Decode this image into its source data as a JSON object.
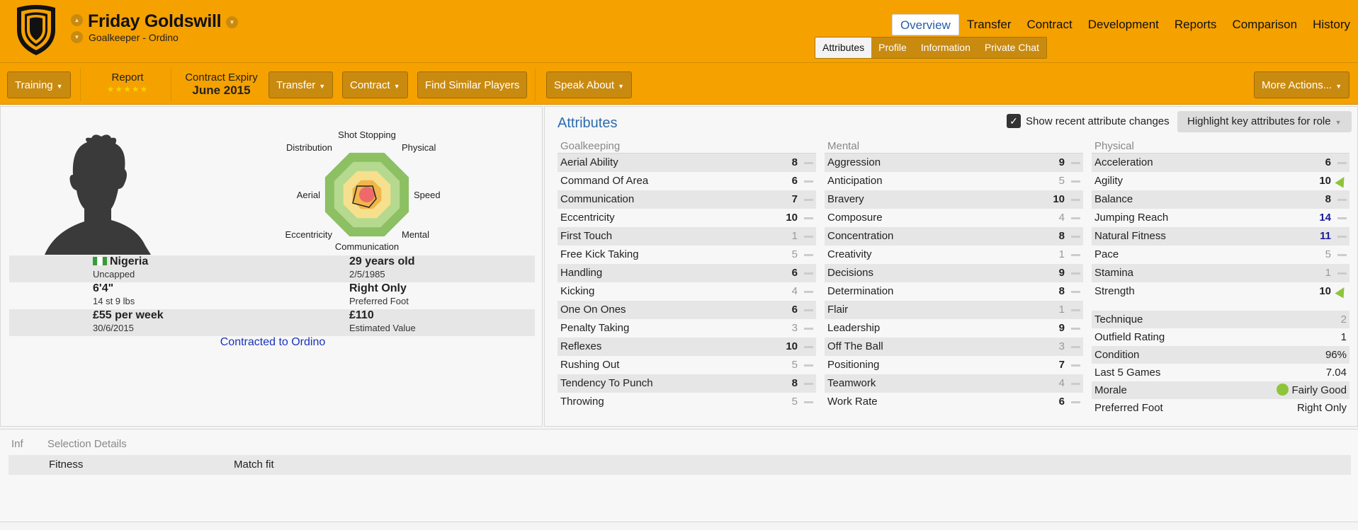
{
  "header": {
    "player_name": "Friday Goldswill",
    "position_club": "Goalkeeper - Ordino",
    "nav_tabs": [
      "Overview",
      "Transfer",
      "Contract",
      "Development",
      "Reports",
      "Comparison",
      "History"
    ],
    "sub_tabs": [
      "Attributes",
      "Profile",
      "Information",
      "Private Chat"
    ],
    "active_nav": "Overview",
    "active_sub": "Attributes"
  },
  "toolbar": {
    "training": "Training",
    "report_label": "Report",
    "report_stars": "★★★★★",
    "contract_expiry_label": "Contract Expiry",
    "contract_expiry_value": "June 2015",
    "transfer": "Transfer",
    "contract": "Contract",
    "find_similar": "Find Similar Players",
    "speak_about": "Speak About",
    "more_actions": "More Actions..."
  },
  "profile": {
    "nationality": "Nigeria",
    "caps": "Uncapped",
    "age": "29 years old",
    "dob": "2/5/1985",
    "height": "6'4\"",
    "weight": "14 st 9 lbs",
    "foot": "Right Only",
    "foot_label": "Preferred Foot",
    "wage": "£55 per week",
    "wage_expiry": "30/6/2015",
    "value": "£110",
    "value_label": "Estimated Value",
    "contracted": "Contracted to Ordino"
  },
  "radar": {
    "labels": [
      "Shot Stopping",
      "Physical",
      "Speed",
      "Mental",
      "Communication",
      "Eccentricity",
      "Aerial",
      "Distribution"
    ],
    "colors": {
      "outer": "#8cc063",
      "mid": "#b5d98e",
      "inner": "#f6e08e",
      "core": "#f2b54a",
      "dot": "#ee6a6a"
    }
  },
  "attributes": {
    "title": "Attributes",
    "show_changes_label": "Show recent attribute changes",
    "highlight_label": "Highlight key attributes for role",
    "goalkeeping": {
      "header": "Goalkeeping",
      "rows": [
        {
          "name": "Aerial Ability",
          "value": "8"
        },
        {
          "name": "Command Of Area",
          "value": "6"
        },
        {
          "name": "Communication",
          "value": "7"
        },
        {
          "name": "Eccentricity",
          "value": "10"
        },
        {
          "name": "First Touch",
          "value": "1"
        },
        {
          "name": "Free Kick Taking",
          "value": "5"
        },
        {
          "name": "Handling",
          "value": "6"
        },
        {
          "name": "Kicking",
          "value": "4"
        },
        {
          "name": "One On Ones",
          "value": "6"
        },
        {
          "name": "Penalty Taking",
          "value": "3"
        },
        {
          "name": "Reflexes",
          "value": "10"
        },
        {
          "name": "Rushing Out",
          "value": "5"
        },
        {
          "name": "Tendency To Punch",
          "value": "8"
        },
        {
          "name": "Throwing",
          "value": "5"
        }
      ]
    },
    "mental": {
      "header": "Mental",
      "rows": [
        {
          "name": "Aggression",
          "value": "9"
        },
        {
          "name": "Anticipation",
          "value": "5"
        },
        {
          "name": "Bravery",
          "value": "10"
        },
        {
          "name": "Composure",
          "value": "4"
        },
        {
          "name": "Concentration",
          "value": "8"
        },
        {
          "name": "Creativity",
          "value": "1"
        },
        {
          "name": "Decisions",
          "value": "9"
        },
        {
          "name": "Determination",
          "value": "8"
        },
        {
          "name": "Flair",
          "value": "1"
        },
        {
          "name": "Leadership",
          "value": "9"
        },
        {
          "name": "Off The Ball",
          "value": "3"
        },
        {
          "name": "Positioning",
          "value": "7"
        },
        {
          "name": "Teamwork",
          "value": "4"
        },
        {
          "name": "Work Rate",
          "value": "6"
        }
      ]
    },
    "physical": {
      "header": "Physical",
      "rows": [
        {
          "name": "Acceleration",
          "value": "6"
        },
        {
          "name": "Agility",
          "value": "10"
        },
        {
          "name": "Balance",
          "value": "8"
        },
        {
          "name": "Jumping Reach",
          "value": "14"
        },
        {
          "name": "Natural Fitness",
          "value": "11"
        },
        {
          "name": "Pace",
          "value": "5"
        },
        {
          "name": "Stamina",
          "value": "1"
        },
        {
          "name": "Strength",
          "value": "10"
        }
      ]
    },
    "extra": {
      "technique_label": "Technique",
      "technique": "2",
      "outfield_label": "Outfield Rating",
      "outfield": "1",
      "condition_label": "Condition",
      "condition": "96%",
      "last5_label": "Last 5 Games",
      "last5": "7.04",
      "morale_label": "Morale",
      "morale": "Fairly Good",
      "pref_foot_label": "Preferred Foot",
      "pref_foot": "Right Only"
    }
  },
  "selection": {
    "col_inf": "Inf",
    "col_details": "Selection Details",
    "row_label": "Fitness",
    "row_value": "Match fit"
  }
}
